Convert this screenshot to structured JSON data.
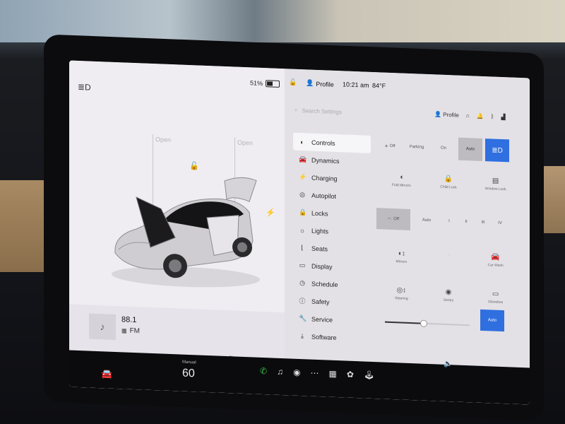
{
  "status": {
    "battery_percent": "51%",
    "battery_level": 0.51,
    "profile": "Profile",
    "time": "10:21 am",
    "temperature": "84°F"
  },
  "car_view": {
    "frunk_label": "Open",
    "trunk_label": "Open"
  },
  "search": {
    "placeholder": "Search Settings"
  },
  "quick": {
    "profile": "Profile"
  },
  "menu": {
    "items": [
      {
        "label": "Controls",
        "icon": "toggle-icon"
      },
      {
        "label": "Dynamics",
        "icon": "car-icon"
      },
      {
        "label": "Charging",
        "icon": "bolt-icon"
      },
      {
        "label": "Autopilot",
        "icon": "steering-wheel-icon"
      },
      {
        "label": "Locks",
        "icon": "lock-icon"
      },
      {
        "label": "Lights",
        "icon": "bulb-icon"
      },
      {
        "label": "Seats",
        "icon": "seat-icon"
      },
      {
        "label": "Display",
        "icon": "display-icon"
      },
      {
        "label": "Schedule",
        "icon": "clock-icon"
      },
      {
        "label": "Safety",
        "icon": "safety-icon"
      },
      {
        "label": "Service",
        "icon": "wrench-icon"
      },
      {
        "label": "Software",
        "icon": "download-icon"
      }
    ],
    "active": "Controls"
  },
  "controls": {
    "lights": {
      "off": "Off",
      "parking": "Parking",
      "on": "On",
      "auto": "Auto"
    },
    "row1": {
      "fold_mirrors": "Fold Mirrors",
      "child_lock": "Child Lock",
      "window_lock": "Window Lock"
    },
    "wipers": {
      "off": "Off",
      "auto": "Auto",
      "speeds": [
        "I",
        "II",
        "III",
        "IV"
      ]
    },
    "row3": {
      "mirrors": "Mirrors",
      "car_wash": "Car Wash"
    },
    "row4": {
      "steering": "Steering",
      "sentry": "Sentry",
      "glovebox": "Glovebox"
    },
    "display_brightness": 0.45,
    "auto_button": "Auto"
  },
  "media": {
    "station": "88.1",
    "band": "FM"
  },
  "bottom": {
    "speed_label": "Manual",
    "speed": "60"
  }
}
